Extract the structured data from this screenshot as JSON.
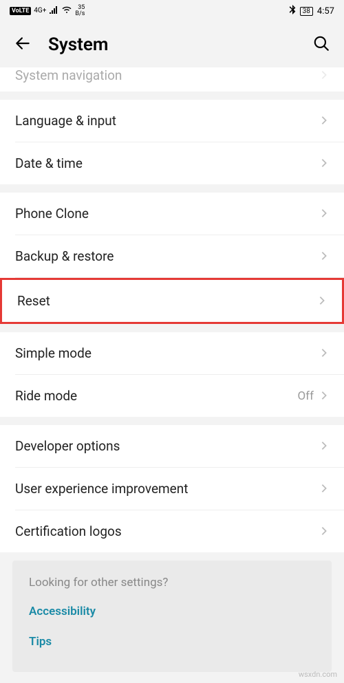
{
  "status": {
    "volte": "VoLTE",
    "network_small": "4G+",
    "speed_num": "35",
    "speed_unit": "B/s",
    "battery_pct": "38",
    "time": "4:57"
  },
  "header": {
    "title": "System"
  },
  "partial_top": {
    "label": "System navigation"
  },
  "group1": {
    "language_input": "Language & input",
    "date_time": "Date & time"
  },
  "group2": {
    "phone_clone": "Phone Clone",
    "backup_restore": "Backup & restore",
    "reset": "Reset"
  },
  "group3": {
    "simple_mode": "Simple mode",
    "ride_mode": "Ride mode",
    "ride_mode_value": "Off"
  },
  "group4": {
    "developer": "Developer options",
    "ux_improvement": "User experience improvement",
    "cert_logos": "Certification logos"
  },
  "footer": {
    "prompt": "Looking for other settings?",
    "accessibility": "Accessibility",
    "tips": "Tips"
  },
  "watermark": "wsxdn.com"
}
